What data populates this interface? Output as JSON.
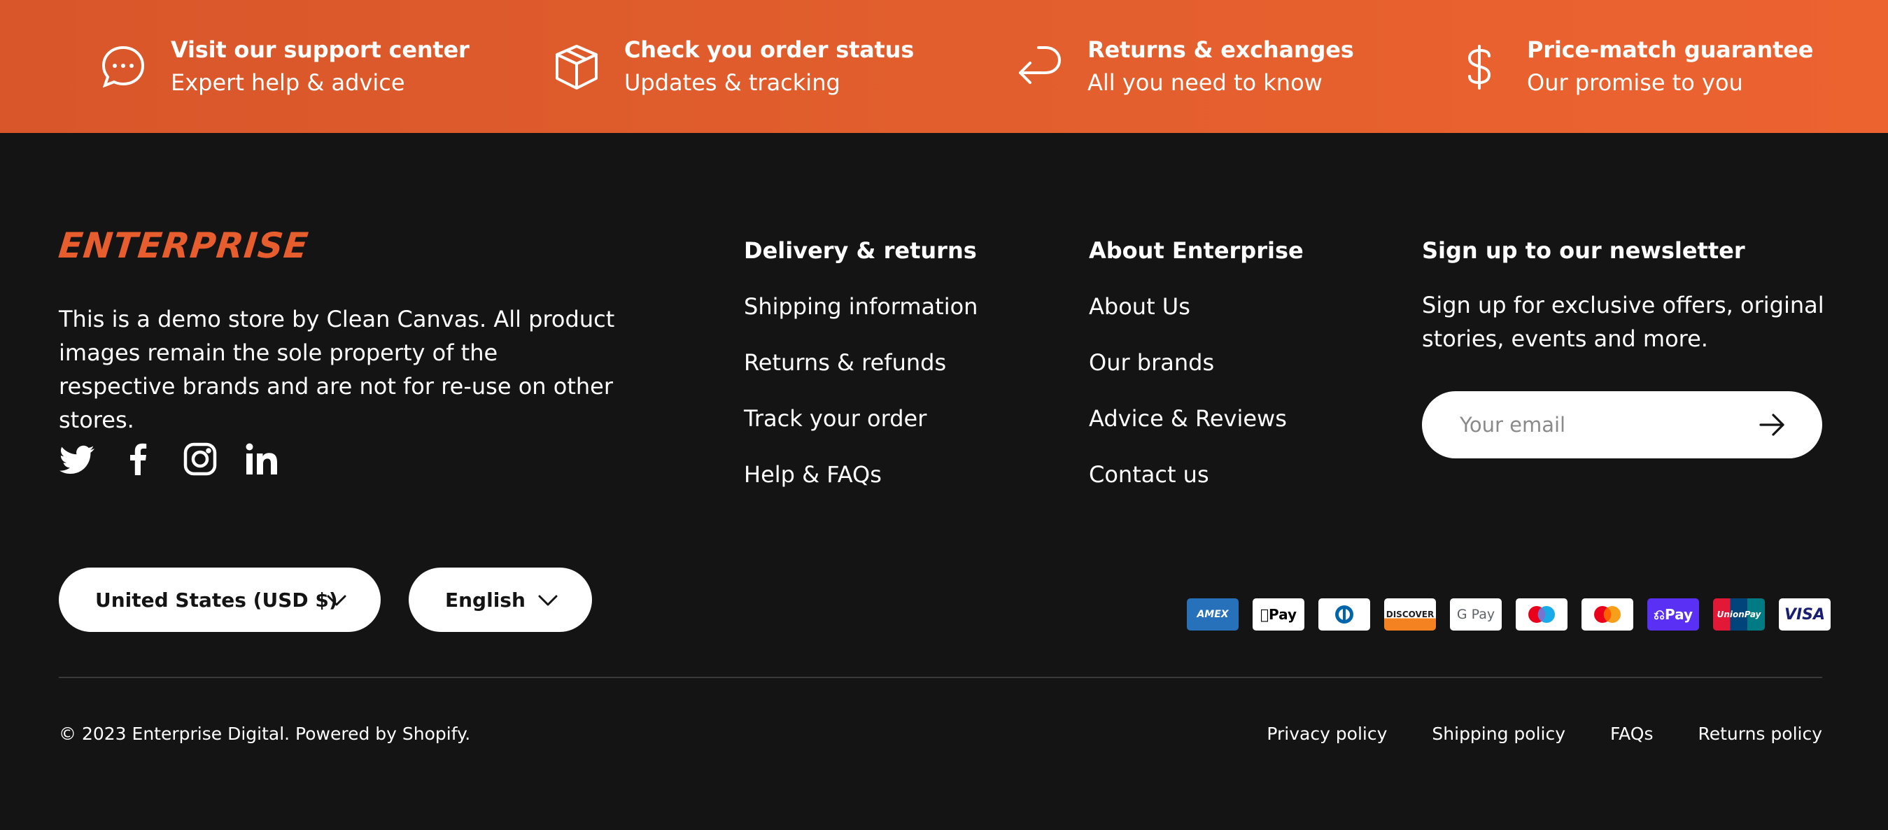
{
  "banner": {
    "features": [
      {
        "title": "Visit our support center",
        "subtitle": "Expert help & advice",
        "icon": "chat-bubble-icon"
      },
      {
        "title": "Check you order status",
        "subtitle": "Updates & tracking",
        "icon": "box-icon"
      },
      {
        "title": "Returns & exchanges",
        "subtitle": "All you need to know",
        "icon": "return-arrow-icon"
      },
      {
        "title": "Price-match guarantee",
        "subtitle": "Our promise to you",
        "icon": "dollar-icon"
      }
    ]
  },
  "brand": {
    "logo": "ENTERPRISE",
    "about": "This is a demo store by Clean Canvas. All product images remain the sole property of the respective brands and are not for re-use on other stores.",
    "socials": [
      "twitter-icon",
      "facebook-icon",
      "instagram-icon",
      "linkedin-icon"
    ]
  },
  "columns": {
    "delivery": {
      "heading": "Delivery & returns",
      "links": [
        "Shipping information",
        "Returns & refunds",
        "Track your order",
        "Help & FAQs"
      ]
    },
    "about": {
      "heading": "About Enterprise",
      "links": [
        "About Us",
        "Our brands",
        "Advice & Reviews",
        "Contact us"
      ]
    },
    "newsletter": {
      "heading": "Sign up to our newsletter",
      "text": "Sign up for exclusive offers, original stories, events and more.",
      "placeholder": "Your email"
    }
  },
  "selectors": {
    "country": "United States (USD $)",
    "language": "English"
  },
  "payments": [
    "AMEX",
    "Pay",
    "Diners",
    "DISCOVER",
    "G Pay",
    "Maestro",
    "Mastercard",
    "Pay",
    "UnionPay",
    "VISA"
  ],
  "bottom": {
    "copyright": "© 2023 Enterprise Digital. Powered by Shopify.",
    "policies": [
      "Privacy policy",
      "Shipping policy",
      "FAQs",
      "Returns policy"
    ]
  },
  "colors": {
    "accent": "#e85d2e",
    "background": "#141414"
  }
}
